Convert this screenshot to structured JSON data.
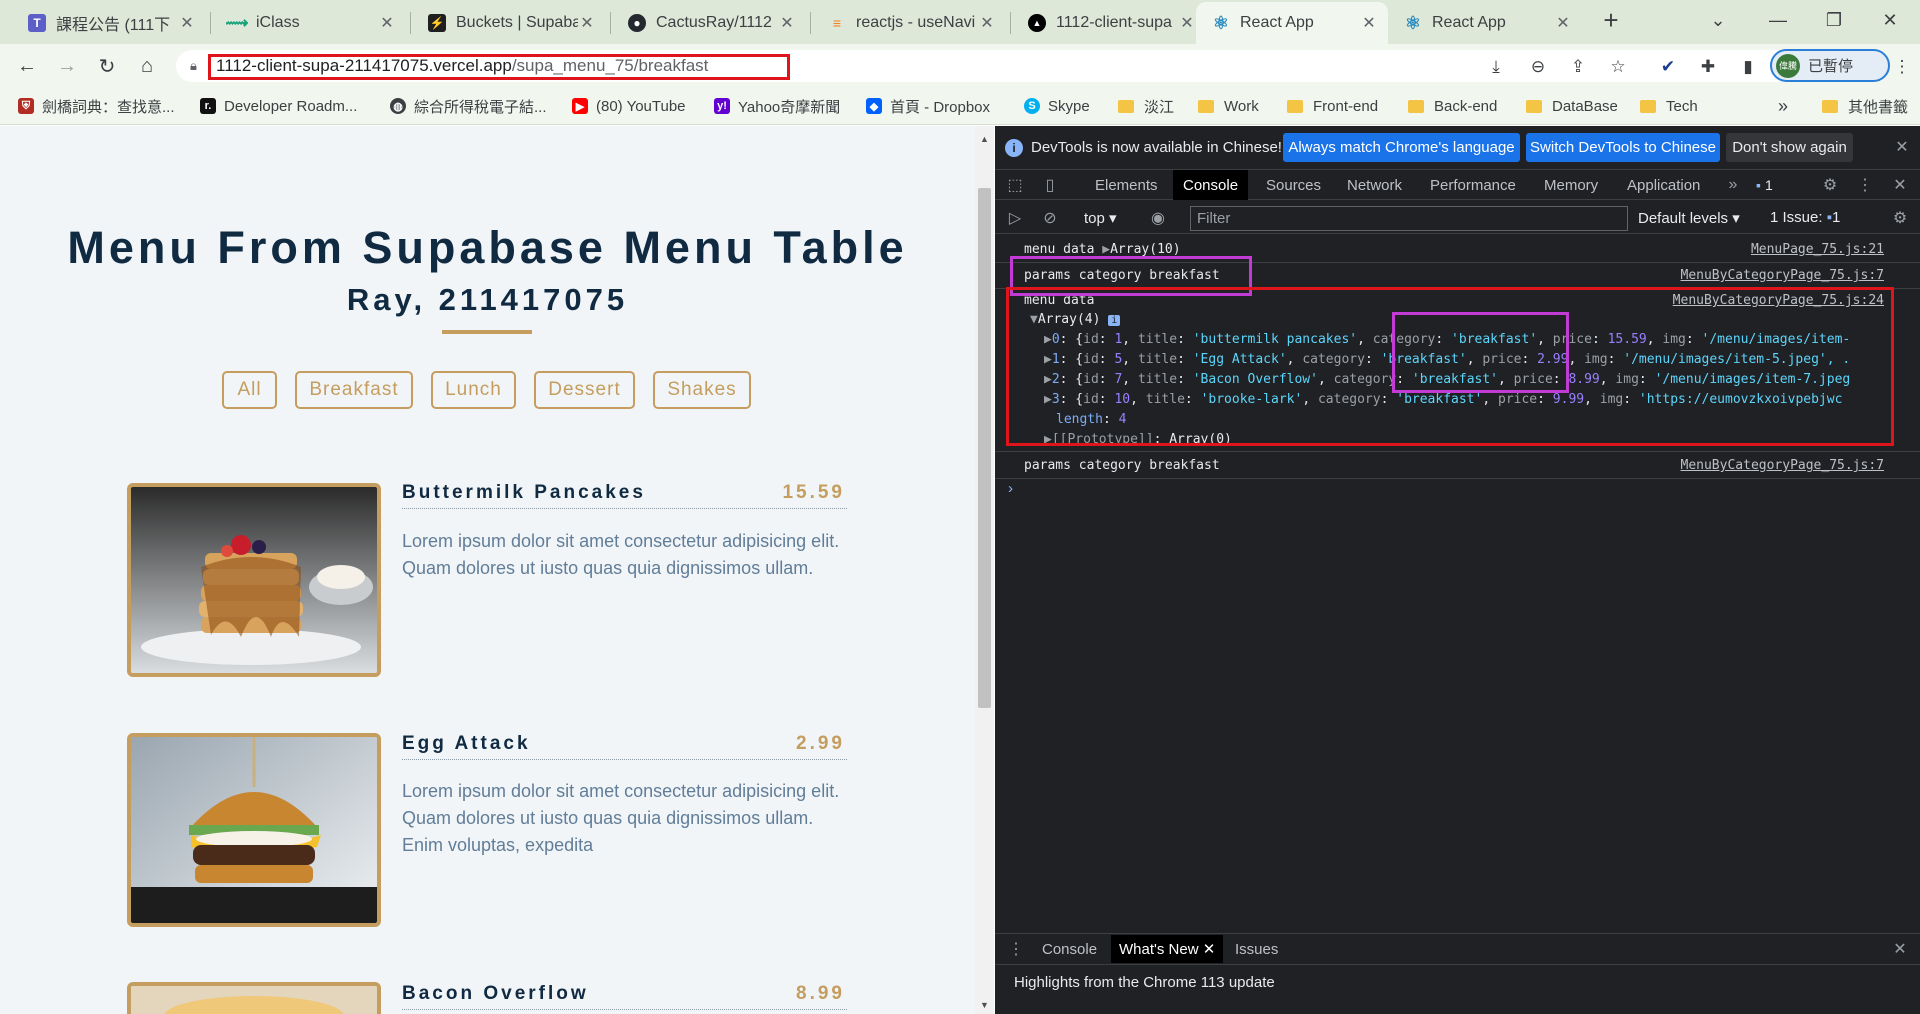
{
  "browser": {
    "tabs": [
      {
        "title": "課程公告 (111下",
        "icon": "teams-icon",
        "color": "#5b5fc7"
      },
      {
        "title": "iClass",
        "icon": "iclass-icon",
        "color": "#1aa37a"
      },
      {
        "title": "Buckets | Supaba",
        "icon": "supabase-icon",
        "color": "#1f1f1f"
      },
      {
        "title": "CactusRay/1112",
        "icon": "github-icon",
        "color": "#24292f"
      },
      {
        "title": "reactjs - useNavi",
        "icon": "stackoverflow-icon",
        "color": "#f48024"
      },
      {
        "title": "1112-client-supa",
        "icon": "vercel-icon",
        "color": "#000000"
      },
      {
        "title": "React App",
        "icon": "react-icon",
        "color": "#61dafb"
      },
      {
        "title": "React App",
        "icon": "react-icon",
        "color": "#61dafb"
      }
    ],
    "url_host": "1112-client-supa-211417075.vercel.app",
    "url_path": "/supa_menu_75/breakfast",
    "profile_label": "已暫停",
    "profile_initials": "偉騰",
    "bookmarks": [
      {
        "label": "劍橋詞典：查找意...",
        "icon": "cambridge-icon"
      },
      {
        "label": "Developer Roadm...",
        "icon": "roadmap-icon"
      },
      {
        "label": "綜合所得稅電子結...",
        "icon": "globe-icon"
      },
      {
        "label": "(80) YouTube",
        "icon": "youtube-icon"
      },
      {
        "label": "Yahoo奇摩新聞",
        "icon": "yahoo-icon"
      },
      {
        "label": "首頁 - Dropbox",
        "icon": "dropbox-icon"
      },
      {
        "label": "Skype",
        "icon": "skype-icon"
      },
      {
        "label": "淡江",
        "icon": "folder-icon"
      },
      {
        "label": "Work",
        "icon": "folder-icon"
      },
      {
        "label": "Front-end",
        "icon": "folder-icon"
      },
      {
        "label": "Back-end",
        "icon": "folder-icon"
      },
      {
        "label": "DataBase",
        "icon": "folder-icon"
      },
      {
        "label": "Tech",
        "icon": "folder-icon"
      }
    ],
    "bookmarks_more": "»",
    "other_bookmarks": "其他書籤"
  },
  "page": {
    "title": "Menu From Supabase Menu Table",
    "subtitle": "Ray, 211417075",
    "filters": [
      "All",
      "Breakfast",
      "Lunch",
      "Dessert",
      "Shakes"
    ],
    "items": [
      {
        "name": "Buttermilk Pancakes",
        "price": "15.59",
        "desc": "Lorem ipsum dolor sit amet consectetur adipisicing elit. Quam dolores ut iusto quas quia dignissimos ullam."
      },
      {
        "name": "Egg Attack",
        "price": "2.99",
        "desc": "Lorem ipsum dolor sit amet consectetur adipisicing elit. Quam dolores ut iusto quas quia dignissimos ullam. Enim voluptas, expedita"
      },
      {
        "name": "Bacon Overflow",
        "price": "8.99",
        "desc": ""
      }
    ]
  },
  "devtools": {
    "banner_text": "DevTools is now available in Chinese!",
    "banner_btn_1": "Always match Chrome's language",
    "banner_btn_2": "Switch DevTools to Chinese",
    "banner_btn_3": "Don't show again",
    "tabs": [
      "Elements",
      "Console",
      "Sources",
      "Network",
      "Performance",
      "Memory",
      "Application"
    ],
    "messages_badge": "1",
    "context": "top",
    "filter_placeholder": "Filter",
    "levels": "Default levels",
    "issues": "1 Issue:",
    "issues_count": "1",
    "logs": {
      "line1": "menu data",
      "line1_arr": "Array(10)",
      "line1_src": "MenuPage_75.js:21",
      "line2": "params category breakfast",
      "line2_src": "MenuByCategoryPage_75.js:7",
      "line3": "menu data",
      "line3_src": "MenuByCategoryPage_75.js:24",
      "array_head": "Array(4)",
      "array_rows": [
        {
          "idx": "0",
          "id": "1",
          "title": "'buttermilk pancakes'",
          "category": "'breakfast'",
          "price": "15.59",
          "img": "'/menu/images/item-"
        },
        {
          "idx": "1",
          "id": "5",
          "title": "'Egg Attack'",
          "category": "'breakfast'",
          "price": "2.99",
          "img": "'/menu/images/item-5.jpeg', ."
        },
        {
          "idx": "2",
          "id": "7",
          "title": "'Bacon Overflow'",
          "category": "'breakfast'",
          "price": "8.99",
          "img": "'/menu/images/item-7.jpeg"
        },
        {
          "idx": "3",
          "id": "10",
          "title": "'brooke-lark'",
          "category": "'breakfast'",
          "price": "9.99",
          "img": "'https://eumovzkxoivpebjwc"
        }
      ],
      "length_label": "length",
      "length_val": "4",
      "prototype": "[[Prototype]]",
      "prototype_val": "Array(0)",
      "line4": "params category breakfast",
      "line4_src": "MenuByCategoryPage_75.js:7"
    },
    "drawer_tabs": [
      "Console",
      "What's New",
      "Issues"
    ],
    "drawer_text": "Highlights from the Chrome 113 update"
  }
}
